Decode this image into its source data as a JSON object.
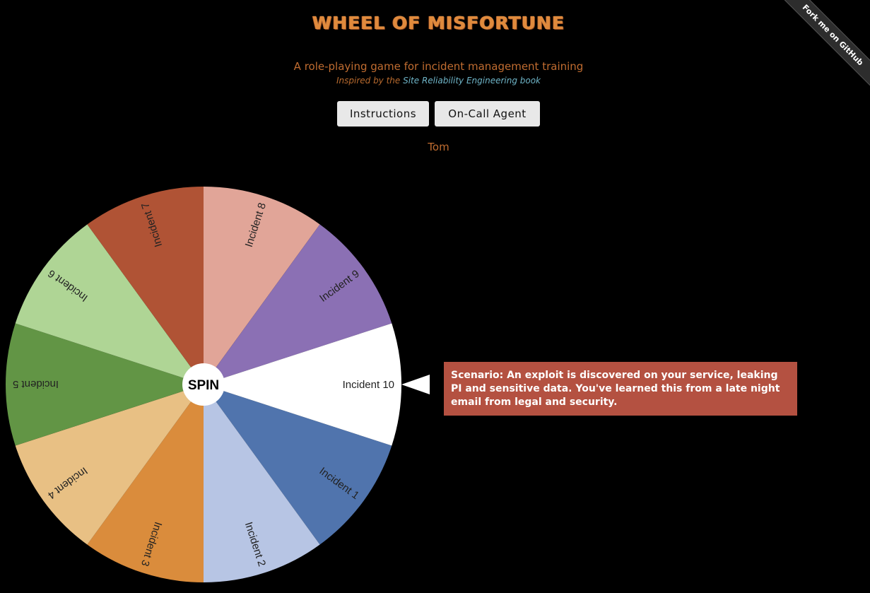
{
  "header": {
    "title": "WHEEL OF MISFORTUNE",
    "subtitle": "A role-playing game for incident management training",
    "inspired_prefix": "Inspired by the ",
    "inspired_link": "Site Reliability Engineering book"
  },
  "buttons": {
    "instructions": "Instructions",
    "oncall_agent": "On-Call Agent"
  },
  "player_name": "Tom",
  "ribbon": "Fork me on GitHub",
  "wheel": {
    "spin_label": "SPIN",
    "segments": [
      {
        "label": "Incident 1",
        "color": "#5074ad"
      },
      {
        "label": "Incident 2",
        "color": "#b7c5e4"
      },
      {
        "label": "Incident 3",
        "color": "#da8c3c"
      },
      {
        "label": "Incident 4",
        "color": "#e8c084"
      },
      {
        "label": "Incident 5",
        "color": "#629545"
      },
      {
        "label": "Incident 6",
        "color": "#afd595"
      },
      {
        "label": "Incident 7",
        "color": "#b05335"
      },
      {
        "label": "Incident 8",
        "color": "#e1a598"
      },
      {
        "label": "Incident 9",
        "color": "#8b70b4"
      },
      {
        "label": "Incident 10",
        "color": "#ffffff"
      }
    ],
    "selected": "Incident 10"
  },
  "scenario": {
    "text": "Scenario: An exploit is discovered on your service, leaking PI and sensitive data. You've learned this from a late night email from legal and security."
  }
}
